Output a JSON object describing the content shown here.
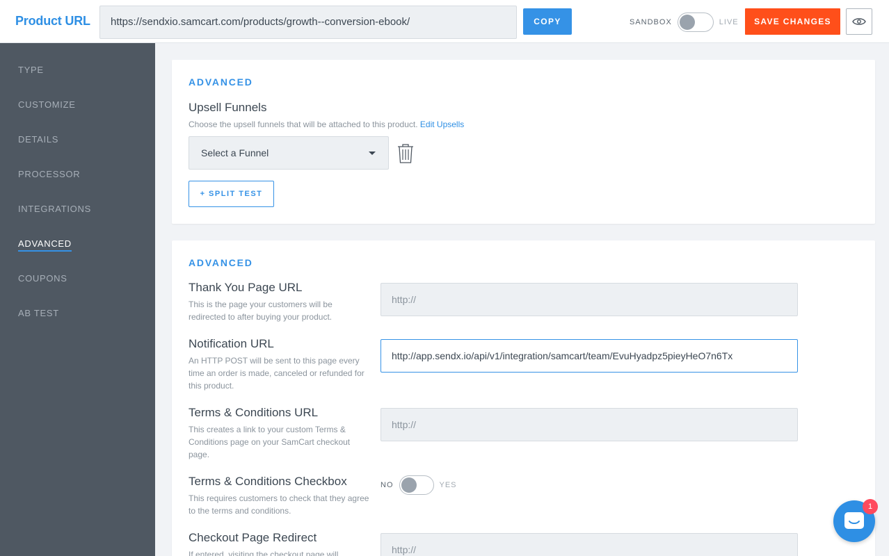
{
  "header": {
    "title": "Product URL",
    "product_url": "https://sendxio.samcart.com/products/growth--conversion-ebook/",
    "copy_label": "COPY",
    "sandbox_label": "SANDBOX",
    "live_label": "LIVE",
    "save_label": "SAVE CHANGES",
    "preview_icon": "eye-icon"
  },
  "sidebar": {
    "items": [
      {
        "label": "TYPE",
        "active": false
      },
      {
        "label": "CUSTOMIZE",
        "active": false
      },
      {
        "label": "DETAILS",
        "active": false
      },
      {
        "label": "PROCESSOR",
        "active": false
      },
      {
        "label": "INTEGRATIONS",
        "active": false
      },
      {
        "label": "ADVANCED",
        "active": true
      },
      {
        "label": "COUPONS",
        "active": false
      },
      {
        "label": "AB TEST",
        "active": false
      }
    ]
  },
  "upsell_card": {
    "section_title": "ADVANCED",
    "field_title": "Upsell Funnels",
    "help": "Choose the upsell funnels that will be attached to this product.",
    "help_link": "Edit Upsells",
    "select_value": "Select a Funnel",
    "split_test_label": "+ SPLIT TEST"
  },
  "advanced_card": {
    "section_title": "ADVANCED",
    "thank_you": {
      "title": "Thank You Page URL",
      "help": "This is the page your customers will be redirected to after buying your product.",
      "placeholder": "http://",
      "value": ""
    },
    "notification": {
      "title": "Notification URL",
      "help": "An HTTP POST will be sent to this page every time an order is made, canceled or refunded for this product.",
      "value": "http://app.sendx.io/api/v1/integration/samcart/team/EvuHyadpz5pieyHeO7n6Tx"
    },
    "terms_url": {
      "title": "Terms & Conditions URL",
      "help": "This creates a link to your custom Terms & Conditions page on your SamCart checkout page.",
      "placeholder": "http://",
      "value": ""
    },
    "terms_checkbox": {
      "title": "Terms & Conditions Checkbox",
      "help": "This requires customers to check that they agree to the terms and conditions.",
      "no_label": "NO",
      "yes_label": "YES"
    },
    "redirect": {
      "title": "Checkout Page Redirect",
      "help": "If entered, visiting the checkout page will",
      "placeholder": "http://",
      "value": ""
    }
  },
  "chat": {
    "badge_count": "1"
  },
  "colors": {
    "accent": "#3592e6",
    "save": "#ff4f1a",
    "sidebar_bg": "#4f5862",
    "badge": "#ff4a5d"
  }
}
